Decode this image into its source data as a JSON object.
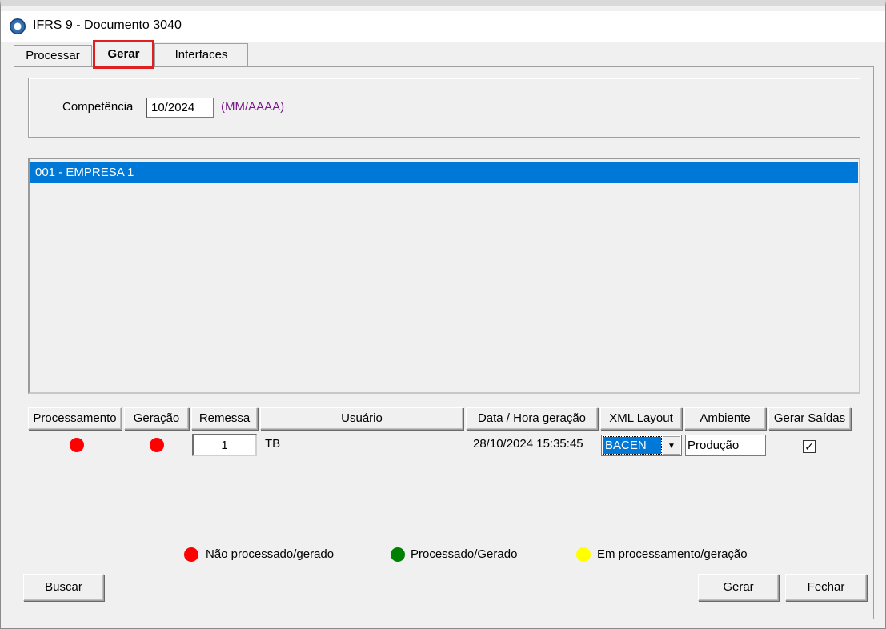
{
  "window": {
    "title": "IFRS 9 - Documento 3040"
  },
  "tabs": [
    {
      "label": "Processar",
      "active": false
    },
    {
      "label": "Gerar",
      "active": true
    },
    {
      "label": "Interfaces",
      "active": false
    }
  ],
  "competencia": {
    "label": "Competência",
    "value": "10/2024",
    "hint": "(MM/AAAA)"
  },
  "empresas": [
    {
      "label": "001 - EMPRESA 1",
      "selected": true
    }
  ],
  "grid": {
    "columns": {
      "processamento": "Processamento",
      "geracao": "Geração",
      "remessa": "Remessa",
      "usuario": "Usuário",
      "data_hora": "Data / Hora geração",
      "xml_layout": "XML Layout",
      "ambiente": "Ambiente",
      "gerar_saidas": "Gerar Saídas"
    },
    "row": {
      "processamento_status": "Não processado/gerado",
      "processamento_color": "#ff0000",
      "geracao_status": "Não processado/gerado",
      "geracao_color": "#ff0000",
      "remessa": "1",
      "usuario": "TB",
      "data_hora": "28/10/2024 15:35:45",
      "xml_layout": "BACEN",
      "ambiente": "Produção",
      "gerar_saidas_checked": true,
      "check_glyph": "✓"
    }
  },
  "legend": [
    {
      "label": "Não processado/gerado",
      "color": "#ff0000"
    },
    {
      "label": "Processado/Gerado",
      "color": "#008000"
    },
    {
      "label": "Em processamento/geração",
      "color": "#ffff00"
    }
  ],
  "buttons": {
    "buscar": "Buscar",
    "gerar": "Gerar",
    "fechar": "Fechar"
  },
  "icons": {
    "app": "app-logo-icon",
    "dropdown": "chevron-down-icon",
    "dropdown_glyph": "▼"
  }
}
